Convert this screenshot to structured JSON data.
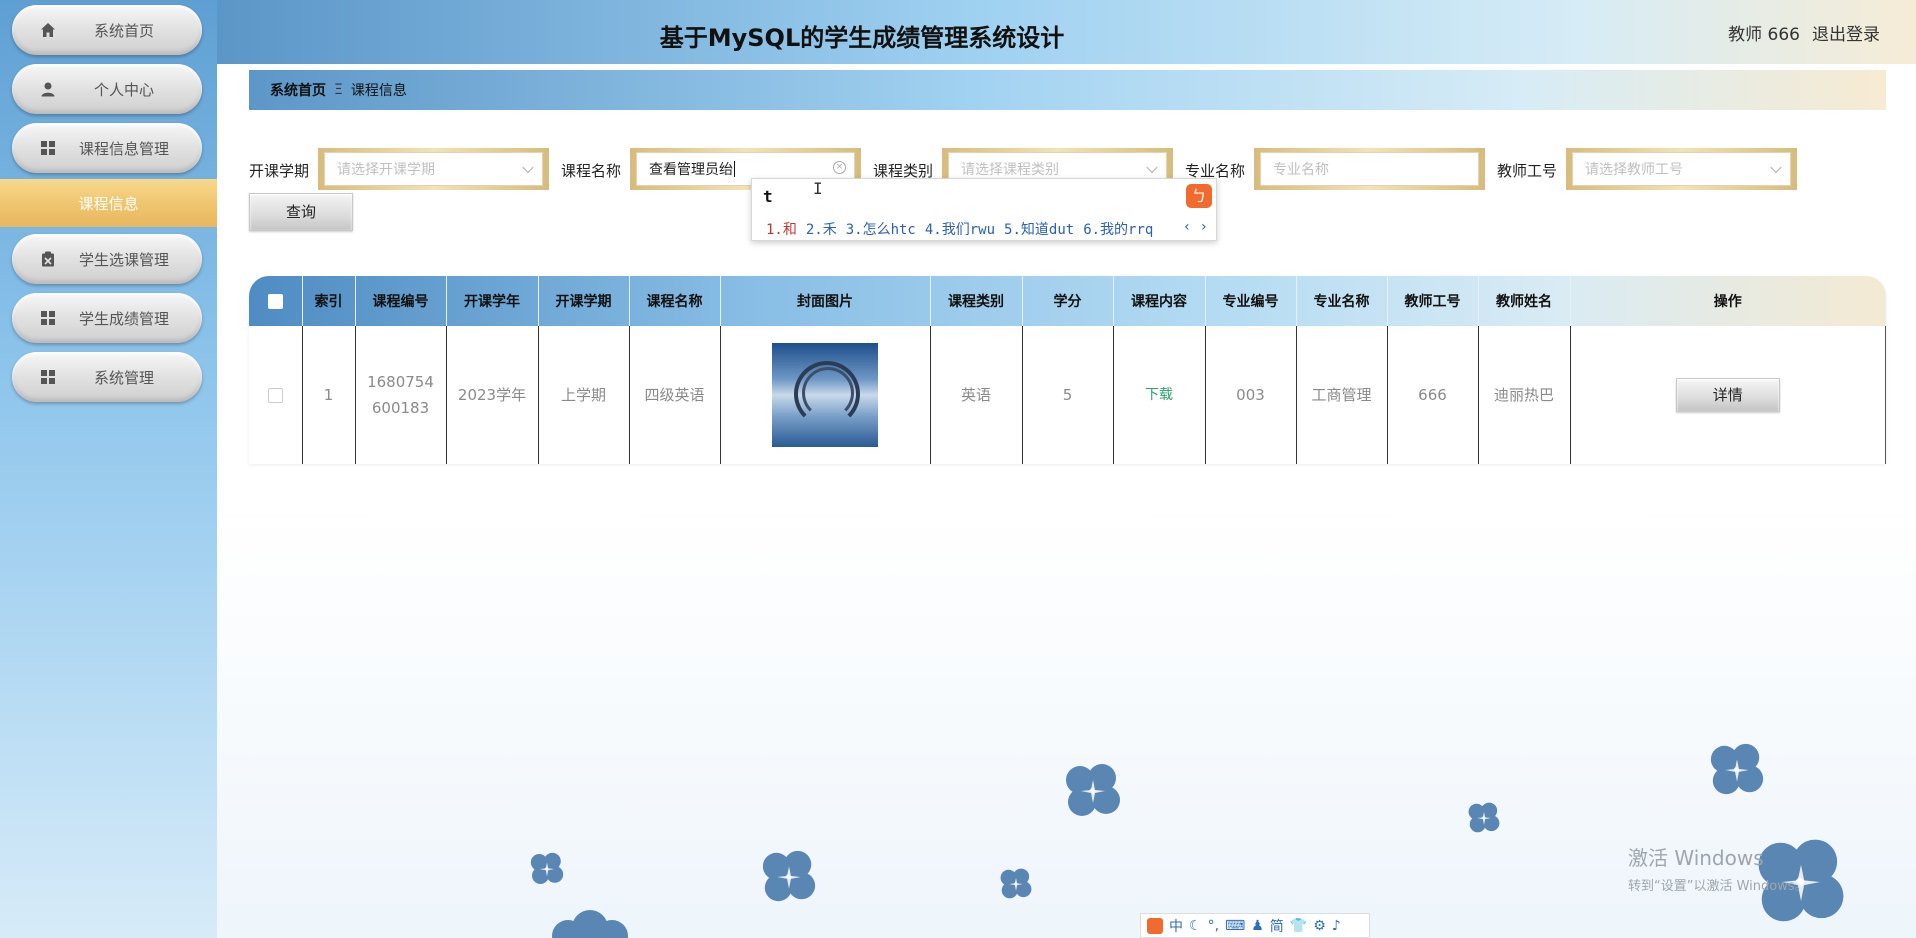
{
  "sidebar": {
    "items": [
      {
        "label": "系统首页",
        "icon": "home-icon"
      },
      {
        "label": "个人中心",
        "icon": "user-icon"
      },
      {
        "label": "课程信息管理",
        "icon": "grid-icon"
      },
      {
        "label": "学生选课管理",
        "icon": "clipboard-icon"
      },
      {
        "label": "学生成绩管理",
        "icon": "grid-icon"
      },
      {
        "label": "系统管理",
        "icon": "grid-icon"
      }
    ],
    "active_sub": "课程信息"
  },
  "header": {
    "title": "基于MySQL的学生成绩管理系统设计",
    "user": "教师 666",
    "logout": "退出登录"
  },
  "breadcrumb": {
    "home": "系统首页",
    "separator": "Ξ",
    "current": "课程信息"
  },
  "search": {
    "term_label": "开课学期",
    "term_placeholder": "请选择开课学期",
    "course_label": "课程名称",
    "course_value": "查看管理员绐",
    "category_label": "课程类别",
    "category_placeholder": "请选择课程类别",
    "major_label": "专业名称",
    "major_placeholder": "专业名称",
    "teacher_label": "教师工号",
    "teacher_placeholder": "请选择教师工号",
    "query_label": "查询"
  },
  "ime_popup": {
    "typed": "t",
    "candidates": [
      "1.和",
      "2.禾",
      "3.怎么htc",
      "4.我们rwu",
      "5.知道dut",
      "6.我的rrq"
    ],
    "nav": "‹ ›"
  },
  "table": {
    "columns": [
      "索引",
      "课程编号",
      "开课学年",
      "开课学期",
      "课程名称",
      "封面图片",
      "课程类别",
      "学分",
      "课程内容",
      "专业编号",
      "专业名称",
      "教师工号",
      "教师姓名",
      "操作"
    ],
    "rows": [
      {
        "index": "1",
        "course_no": "1680754600183",
        "year": "2023学年",
        "term": "上学期",
        "name": "四级英语",
        "category": "英语",
        "credit": "5",
        "content": "下载",
        "major_no": "003",
        "major": "工商管理",
        "teacher_no": "666",
        "teacher_name": "迪丽热巴",
        "action": "详情"
      }
    ]
  },
  "watermark": {
    "line1": "激活 Windows",
    "line2": "转到“设置”以激活 Windows。"
  },
  "ime_bar": {
    "mode": "中",
    "simplified": "简"
  },
  "colors": {
    "sidebar_top": "#5e9fd3",
    "active_gold": "#efc46e",
    "flower": "#5a86b3"
  }
}
